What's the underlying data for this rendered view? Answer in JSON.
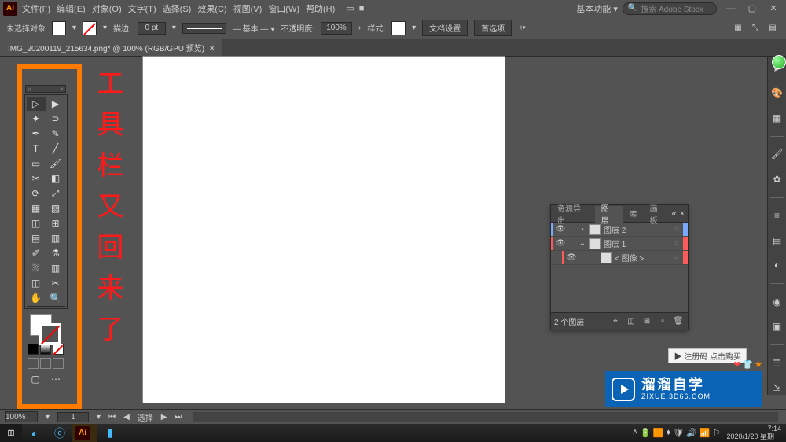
{
  "menubar": {
    "items": [
      "文件(F)",
      "编辑(E)",
      "对象(O)",
      "文字(T)",
      "选择(S)",
      "效果(C)",
      "视图(V)",
      "窗口(W)",
      "帮助(H)"
    ],
    "workspace": "基本功能",
    "search_placeholder": "搜索 Adobe Stock"
  },
  "optbar": {
    "no_selection": "未选择对象",
    "stroke_label": "描边:",
    "stroke_pt": "0 pt",
    "style_label": "基本",
    "opacity_label": "不透明度:",
    "opacity_val": "100%",
    "style2_label": "样式:",
    "doc_setup": "文档设置",
    "prefs": "首选项"
  },
  "doctab": {
    "title": "IMG_20200119_215634.png* @ 100% (RGB/GPU 预览)"
  },
  "annotation": "工具栏又回来了",
  "layers": {
    "tabs": [
      "资源导出",
      "图层",
      "库",
      "画板"
    ],
    "rows": [
      {
        "name": "图层 2",
        "accent": "#7aa8ff"
      },
      {
        "name": "图层 1",
        "accent": "#ff5a5a",
        "expanded": true
      },
      {
        "name": "< 图像 >",
        "child": true,
        "accent": "#ff5a5a"
      }
    ],
    "footer_count": "2 个图层"
  },
  "status": {
    "zoom": "100%",
    "nav": "1",
    "tool": "选择"
  },
  "taskbar": {
    "time": "7:14",
    "date": "2020/1/20 星期一"
  },
  "watermark": {
    "cn": "溜溜自学",
    "en": "ZIXUE.3D66.COM"
  },
  "tooltip": "▶ 注册码  点击购买",
  "tools_glyphs": [
    "▷",
    "▶",
    "✦",
    "▭",
    "🖌",
    "✎",
    "T",
    "╱",
    "◻",
    "✂",
    "⟳",
    "⤢",
    "▦",
    "▧",
    "◫",
    "⊞",
    "〓",
    "▥",
    "✏",
    "⚗",
    "▤",
    "⫿",
    "📊",
    "⌖",
    "◐",
    "✋",
    "🔍",
    "⋯",
    "⋯",
    "⋯"
  ]
}
